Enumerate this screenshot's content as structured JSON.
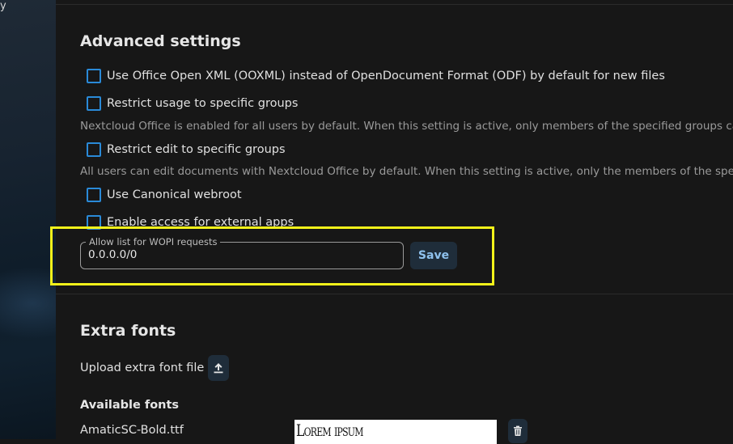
{
  "sidebar": {
    "truncated_text": "y"
  },
  "advanced": {
    "title": "Advanced settings",
    "options": [
      {
        "label": "Use Office Open XML (OOXML) instead of OpenDocument Format (ODF) by default for new files",
        "checked": false
      },
      {
        "label": "Restrict usage to specific groups",
        "checked": false,
        "hint": "Nextcloud Office is enabled for all users by default. When this setting is active, only members of the specified groups can"
      },
      {
        "label": "Restrict edit to specific groups",
        "checked": false,
        "hint": "All users can edit documents with Nextcloud Office by default. When this setting is active, only the members of the speci"
      },
      {
        "label": "Use Canonical webroot",
        "checked": false
      },
      {
        "label": "Enable access for external apps",
        "checked": false
      }
    ],
    "wopi": {
      "legend": "Allow list for WOPI requests",
      "value": "0.0.0.0/0",
      "save_label": "Save"
    }
  },
  "fonts": {
    "title": "Extra fonts",
    "upload_label": "Upload extra font file",
    "available_title": "Available fonts",
    "items": [
      {
        "name": "AmaticSC-Bold.ttf",
        "preview": "Lorem ipsum"
      }
    ]
  },
  "colors": {
    "accent": "#2a8ad8",
    "highlight": "#f2f21a",
    "button_bg": "#1f2d3a",
    "button_text": "#8fc2ee"
  }
}
